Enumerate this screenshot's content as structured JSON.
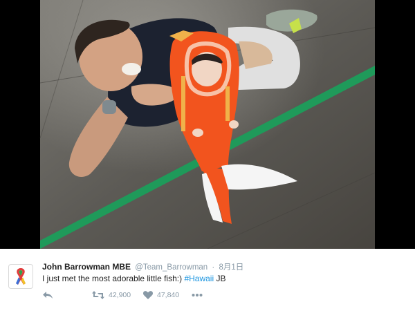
{
  "tweet": {
    "author_name": "John Barrowman MBE",
    "handle": "@Team_Barrowman",
    "separator": "·",
    "date": "8月1日",
    "text": "I just met the most adorable little fish:)",
    "hashtag": "#Hawaii",
    "signature": "JB",
    "retweet_count": "42,900",
    "like_count": "47,840"
  },
  "icons": {
    "reply": "reply-icon",
    "retweet": "retweet-icon",
    "like": "heart-icon",
    "more": "more-dots-icon",
    "avatar": "awareness-ribbon-icon"
  },
  "colors": {
    "hashtag": "#1b95e0",
    "meta_gray": "#8899a6",
    "costume_orange": "#f2541e",
    "floor_stripe_green": "#1f9a5a"
  }
}
